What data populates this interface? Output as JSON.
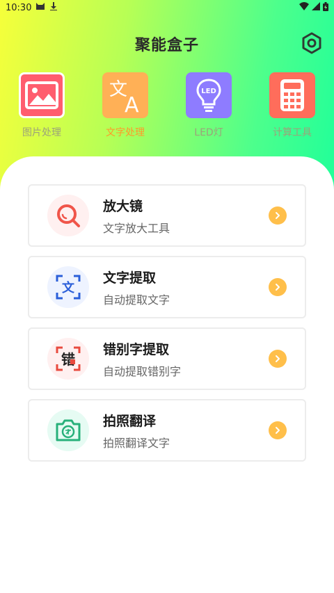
{
  "status_bar": {
    "time": "10:30",
    "icons": [
      "cat-icon",
      "download-icon",
      "wifi-icon",
      "signal-icon",
      "battery-icon"
    ]
  },
  "header": {
    "title": "聚能盒子",
    "settings_icon": "hexagon-settings-icon"
  },
  "tabs": [
    {
      "label": "图片处理",
      "icon": "image-icon",
      "color": "#ff5d6e",
      "active": false
    },
    {
      "label": "文字处理",
      "icon": "translate-icon",
      "color": "#ffb056",
      "active": true
    },
    {
      "label": "LED灯",
      "icon": "bulb-icon",
      "color": "#8e7cff",
      "active": false
    },
    {
      "label": "计算工具",
      "icon": "calculator-icon",
      "color": "#ff6d5b",
      "active": false
    }
  ],
  "items": [
    {
      "title": "放大镜",
      "subtitle": "文字放大工具",
      "icon": "magnifier-icon",
      "icon_bg": "#fff0f0",
      "icon_color": "#f0554a"
    },
    {
      "title": "文字提取",
      "subtitle": "自动提取文字",
      "icon": "text-scan-icon",
      "icon_bg": "#eef3ff",
      "icon_color": "#2b5fd9",
      "icon_text": "文"
    },
    {
      "title": "错别字提取",
      "subtitle": "自动提取错别字",
      "icon": "typo-scan-icon",
      "icon_bg": "#fff0f0",
      "icon_color": "#e84a3e",
      "icon_text": "错"
    },
    {
      "title": "拍照翻译",
      "subtitle": "拍照翻译文字",
      "icon": "camera-translate-icon",
      "icon_bg": "#e6fbf3",
      "icon_color": "#27b07a"
    }
  ],
  "colors": {
    "accent": "#ff9a2a",
    "arrow": "#ffbf4a"
  }
}
